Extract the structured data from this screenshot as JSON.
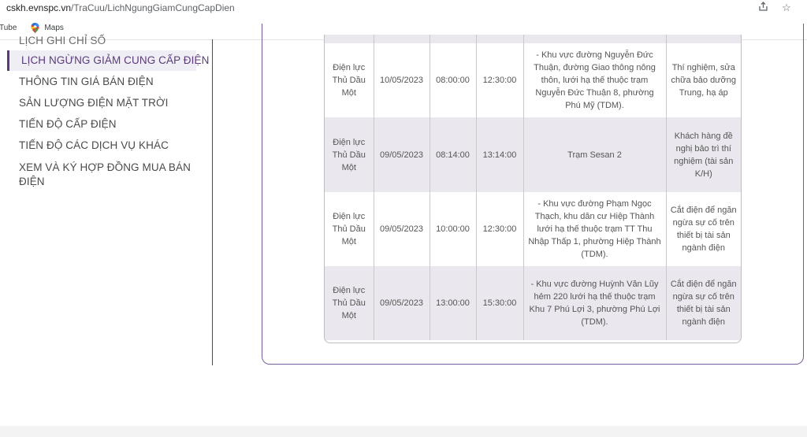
{
  "browser": {
    "url_host": "cskh.evnspc.vn",
    "url_path": "/TraCuu/LichNgungGiamCungCapDien",
    "bookmarks": [
      "Tube",
      "Maps"
    ]
  },
  "sidebar": {
    "items": [
      {
        "label": "LỊCH GHI CHỈ SỐ"
      },
      {
        "label": "LỊCH NGỪNG GIẢM CUNG CẤP ĐIỆN"
      },
      {
        "label": "THÔNG TIN GIÁ BÁN ĐIỆN"
      },
      {
        "label": "SẢN LƯỢNG ĐIỆN MẶT TRỜI"
      },
      {
        "label": "TIẾN ĐỘ CẤP ĐIỆN"
      },
      {
        "label": "TIẾN ĐỘ CÁC DỊCH VỤ KHÁC"
      },
      {
        "label": "XEM VÀ KÝ HỢP ĐỒNG MUA BÁN ĐIỆN"
      }
    ]
  },
  "table": {
    "rows": [
      {
        "unit": "Điện lực Thủ Dầu Một",
        "date": "10/05/2023",
        "start": "08:00:00",
        "end": "12:30:00",
        "area": "- Khu vực đường Nguyễn Đức Thuận, đường Giao thông nông thôn, lưới hạ thế thuộc trạm Nguyễn Đức Thuận 8, phường Phú Mỹ (TDM).",
        "reason": "Thí nghiệm, sửa chữa bảo dưỡng Trung, hạ áp"
      },
      {
        "unit": "Điện lực Thủ Dầu Một",
        "date": "09/05/2023",
        "start": "08:14:00",
        "end": "13:14:00",
        "area": "Trạm Sesan 2",
        "reason": "Khách hàng đề nghị bảo trì thí nghiệm (tài sản K/H)"
      },
      {
        "unit": "Điện lực Thủ Dầu Một",
        "date": "09/05/2023",
        "start": "10:00:00",
        "end": "12:30:00",
        "area": "- Khu vực đường Phạm Ngọc Thạch, khu dân cư Hiệp Thành lưới hạ thế thuộc trạm TT Thu Nhập Thấp 1, phường Hiệp Thành (TDM).",
        "reason": "Cắt điện để ngăn ngừa sự cố trên thiết bị tài sản ngành điện"
      },
      {
        "unit": "Điện lực Thủ Dầu Một",
        "date": "09/05/2023",
        "start": "13:00:00",
        "end": "15:30:00",
        "area": "- Khu vực đường Huỳnh Văn Lũy hẻm 220 lưới hạ thế thuộc trạm Khu 7 Phú Lợi 3, phường Phú Lợi (TDM).",
        "reason": "Cắt điện để ngăn ngừa sự cố trên thiết bị tài sản ngành điện"
      }
    ]
  },
  "icons": {
    "share": "share-icon",
    "bookmark_star": "star-icon",
    "maps": "maps-pin-icon"
  },
  "colors": {
    "accent": "#5a3a7c",
    "row_alt": "#eae7ee"
  }
}
